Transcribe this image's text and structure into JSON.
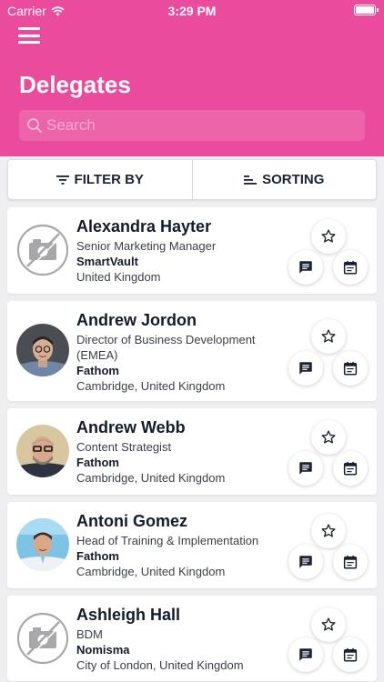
{
  "status_bar": {
    "carrier": "Carrier",
    "time": "3:29 PM"
  },
  "header": {
    "title": "Delegates",
    "search_placeholder": "Search"
  },
  "toolbar": {
    "filter_label": "FILTER BY",
    "sorting_label": "SORTING"
  },
  "colors": {
    "brand": "#eb4b9c",
    "text_dark": "#141c2b"
  },
  "delegates": [
    {
      "name": "Alexandra Hayter",
      "title": "Senior Marketing Manager",
      "company": "SmartVault",
      "location": "United Kingdom",
      "photo": "no-photo"
    },
    {
      "name": "Andrew Jordon",
      "title": "Director of Business Development (EMEA)",
      "company": "Fathom",
      "location": "Cambridge, United Kingdom",
      "photo": "photo"
    },
    {
      "name": "Andrew Webb",
      "title": "Content Strategist",
      "company": "Fathom",
      "location": "Cambridge, United Kingdom",
      "photo": "photo"
    },
    {
      "name": "Antoni Gomez",
      "title": "Head of Training & Implementation",
      "company": "Fathom",
      "location": "Cambridge, United Kingdom",
      "photo": "photo"
    },
    {
      "name": "Ashleigh Hall",
      "title": "BDM",
      "company": "Nomisma",
      "location": "City of London, United Kingdom",
      "photo": "no-photo"
    }
  ]
}
